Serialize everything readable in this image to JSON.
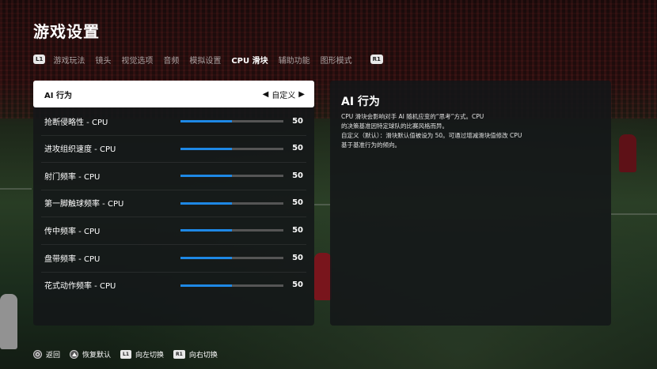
{
  "title": "游戏设置",
  "tabs": {
    "left_key": "L1",
    "right_key": "R1",
    "items": [
      {
        "label": "游戏玩法"
      },
      {
        "label": "镜头"
      },
      {
        "label": "视觉选项"
      },
      {
        "label": "音频"
      },
      {
        "label": "模拟设置"
      },
      {
        "label": "CPU 滑块"
      },
      {
        "label": "辅助功能"
      },
      {
        "label": "图形模式"
      }
    ],
    "active_index": 5
  },
  "selector": {
    "label": "AI 行为",
    "value": "自定义",
    "left_arrow": "◀",
    "right_arrow": "▶"
  },
  "sliders": [
    {
      "label": "抢断侵略性 - CPU",
      "value": "50",
      "fraction": 0.5
    },
    {
      "label": "进攻组织速度 - CPU",
      "value": "50",
      "fraction": 0.5
    },
    {
      "label": "射门频率 - CPU",
      "value": "50",
      "fraction": 0.5
    },
    {
      "label": "第一脚触球频率 - CPU",
      "value": "50",
      "fraction": 0.5
    },
    {
      "label": "传中频率 - CPU",
      "value": "50",
      "fraction": 0.5
    },
    {
      "label": "盘带频率 - CPU",
      "value": "50",
      "fraction": 0.5
    },
    {
      "label": "花式动作频率 - CPU",
      "value": "50",
      "fraction": 0.5
    }
  ],
  "info": {
    "title": "AI 行为",
    "lines": [
      "CPU 滑块会影响对手 AI 随机应变的“思考”方式。CPU",
      "的决策基准因特定球队的比赛风格而异。",
      "自定义（默认）：滑块默认值被设为 50。可通过增减滑块值修改 CPU",
      "基于基准行为的倾向。"
    ]
  },
  "footer": {
    "back": {
      "icon": "circle-button-icon",
      "label": "返回"
    },
    "reset": {
      "icon": "triangle-button-icon",
      "label": "恢复默认"
    },
    "left_switch": {
      "key": "L1",
      "label": "向左切换"
    },
    "right_switch": {
      "key": "R1",
      "label": "向右切换"
    }
  },
  "colors": {
    "accent": "#1e88e5",
    "panel": "#141618",
    "selected_row": "#ffffff"
  }
}
